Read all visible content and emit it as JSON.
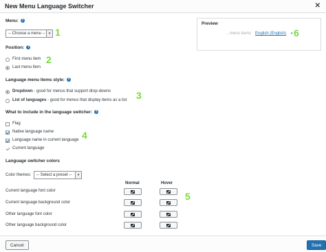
{
  "dialog": {
    "title": "New Menu Language Switcher",
    "close_glyph": "✕"
  },
  "menu": {
    "label": "Menu:",
    "select_value": "-- Choose a menu --",
    "marker": "1"
  },
  "position": {
    "label": "Position:",
    "options": [
      "First menu item",
      "Last menu item"
    ],
    "selected_index": 1,
    "marker": "2"
  },
  "style": {
    "label": "Language menu items style:",
    "options": [
      {
        "bold": "Dropdown",
        "rest": " - good for menus that support drop-downs"
      },
      {
        "bold": "List of languages",
        "rest": " - good for menus that display items as a list"
      }
    ],
    "selected_index": 0,
    "marker": "3"
  },
  "include": {
    "label": "What to include in the language switcher:",
    "items": [
      {
        "label": "Flag",
        "checked": false
      },
      {
        "label": "Native language name",
        "checked": true
      },
      {
        "label": "Language name in current language",
        "checked": true
      },
      {
        "label": "Current language",
        "checked": true
      }
    ],
    "marker": "4"
  },
  "colors": {
    "label": "Language switcher colors",
    "themes_label": "Color themes:",
    "themes_value": "-- Select a preset --",
    "col_normal": "Normal",
    "col_hover": "Hover",
    "rows": [
      "Current language font color",
      "Current language background color",
      "Other language font color",
      "Other language background color"
    ],
    "marker": "5"
  },
  "preview": {
    "title": "Preview",
    "menu_items": "...menu items",
    "current_lang": "English (English)",
    "caret": "▾",
    "marker": "6"
  },
  "footer": {
    "cancel": "Cancel",
    "save": "Save"
  },
  "theme": {
    "accent": "#2271b1",
    "marker_color": "#7ad93d"
  }
}
